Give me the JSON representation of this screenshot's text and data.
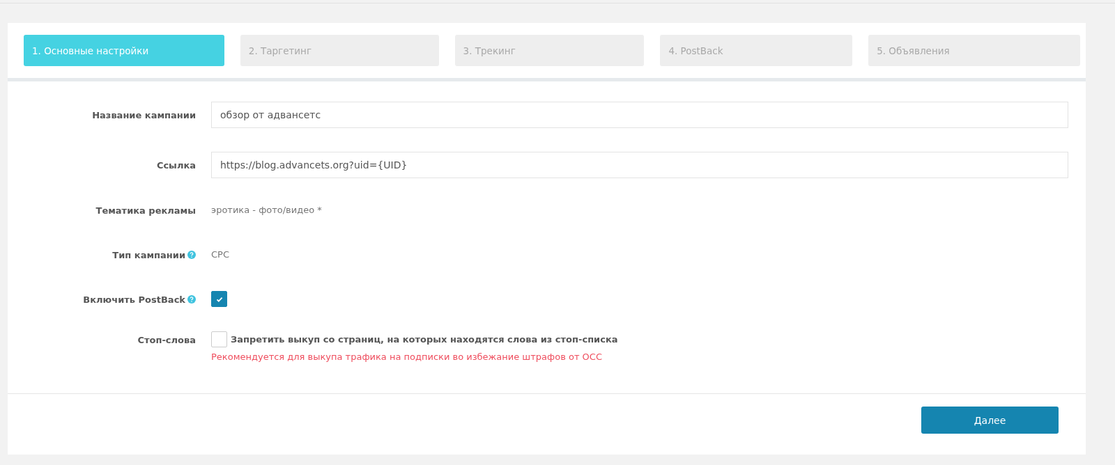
{
  "steps": [
    {
      "label": "1. Основные настройки",
      "selected": true
    },
    {
      "label": "2. Таргетинг",
      "selected": false
    },
    {
      "label": "3. Трекинг",
      "selected": false
    },
    {
      "label": "4. PostBack",
      "selected": false
    },
    {
      "label": "5. Объявления",
      "selected": false
    }
  ],
  "form": [
    {
      "kind": "input",
      "label": "Название кампании",
      "help": false,
      "value": "обзор от адвансетс"
    },
    {
      "kind": "input",
      "label": "Ссылка",
      "help": false,
      "value": "https://blog.advancets.org?uid={UID}"
    },
    {
      "kind": "text",
      "label": "Тематика рекламы",
      "help": false,
      "value": "эротика - фото/видео *"
    },
    {
      "kind": "text",
      "label": "Тип кампании",
      "help": true,
      "value": "CPC"
    },
    {
      "kind": "checkbox",
      "label": "Включить PostBack",
      "help": true,
      "checked": true
    },
    {
      "kind": "checkbox",
      "label": "Стоп-слова",
      "help": false,
      "checked": false,
      "option": "Запретить выкуп со страниц, на которых находятся слова из стоп-списка",
      "note": "Рекомендуется для выкупа трафика на подписки во избежание штрафов от ОСС"
    }
  ],
  "next_button": "Далее"
}
